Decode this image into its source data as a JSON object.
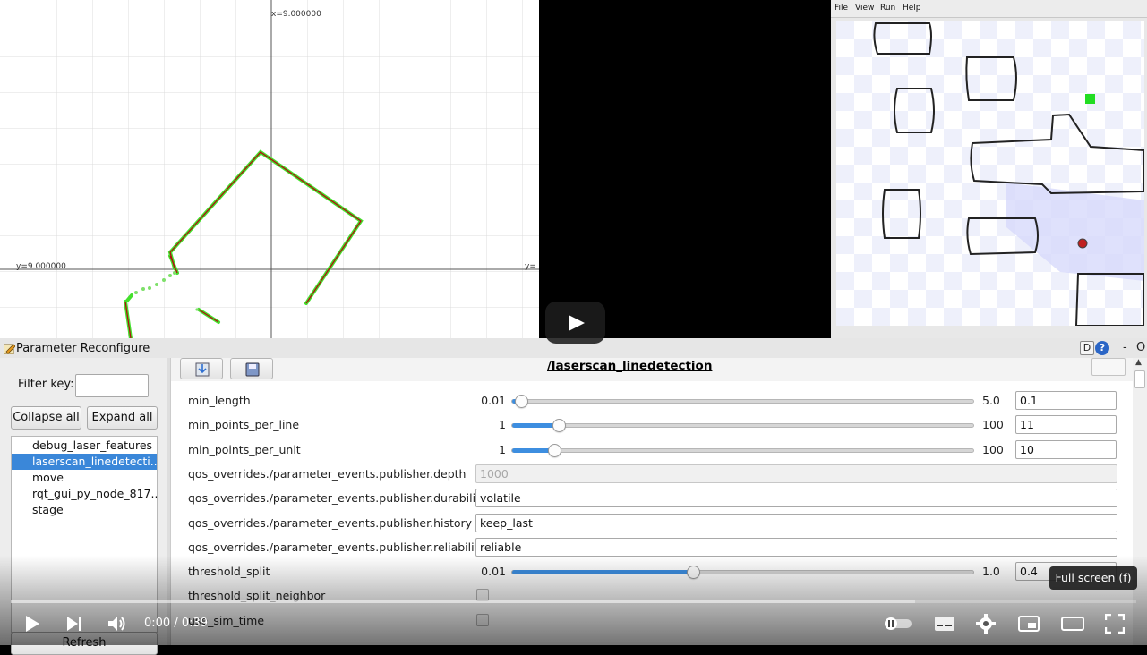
{
  "plot": {
    "x_axis_label": "x=9.000000",
    "y_axis_label": "y=9.000000",
    "y_axis_label_right": "y="
  },
  "simulator": {
    "menu": [
      "File",
      "View",
      "Run",
      "Help"
    ]
  },
  "rqt": {
    "window_title": "Parameter Reconfigure",
    "title_controls": {
      "d": "D",
      "help": "?",
      "minimize": "-",
      "close": "O"
    },
    "filter_label": "Filter key:",
    "filter_value": "",
    "collapse_all": "Collapse all",
    "expand_all": "Expand all",
    "refresh": "Refresh",
    "nodes": [
      {
        "label": "debug_laser_features",
        "selected": false
      },
      {
        "label": "laserscan_linedetecti...",
        "selected": true
      },
      {
        "label": "move",
        "selected": false
      },
      {
        "label": "rqt_gui_py_node_817...",
        "selected": false
      },
      {
        "label": "stage",
        "selected": false
      }
    ],
    "node_title": "/laserscan_linedetection",
    "params": [
      {
        "name": "min_length",
        "kind": "slider",
        "min": "0.01",
        "max": "5.0",
        "value": "0.1",
        "fraction": 0.02
      },
      {
        "name": "min_points_per_line",
        "kind": "slider",
        "min": "1",
        "max": "100",
        "value": "11",
        "fraction": 0.1
      },
      {
        "name": "min_points_per_unit",
        "kind": "slider",
        "min": "1",
        "max": "100",
        "value": "10",
        "fraction": 0.09
      },
      {
        "name": "qos_overrides./parameter_events.publisher.depth",
        "kind": "text",
        "value": "1000",
        "disabled": true
      },
      {
        "name": "qos_overrides./parameter_events.publisher.durability",
        "kind": "text",
        "value": "volatile"
      },
      {
        "name": "qos_overrides./parameter_events.publisher.history",
        "kind": "text",
        "value": "keep_last"
      },
      {
        "name": "qos_overrides./parameter_events.publisher.reliability",
        "kind": "text",
        "value": "reliable"
      },
      {
        "name": "threshold_split",
        "kind": "slider",
        "min": "0.01",
        "max": "1.0",
        "value": "0.4",
        "fraction": 0.39
      },
      {
        "name": "threshold_split_neighbor",
        "kind": "check",
        "checked": false
      },
      {
        "name": "use_sim_time",
        "kind": "check",
        "checked": false
      }
    ]
  },
  "player": {
    "time": "0:00 / 0:39",
    "tooltip": "Full screen (f)",
    "progress": 0.0
  }
}
